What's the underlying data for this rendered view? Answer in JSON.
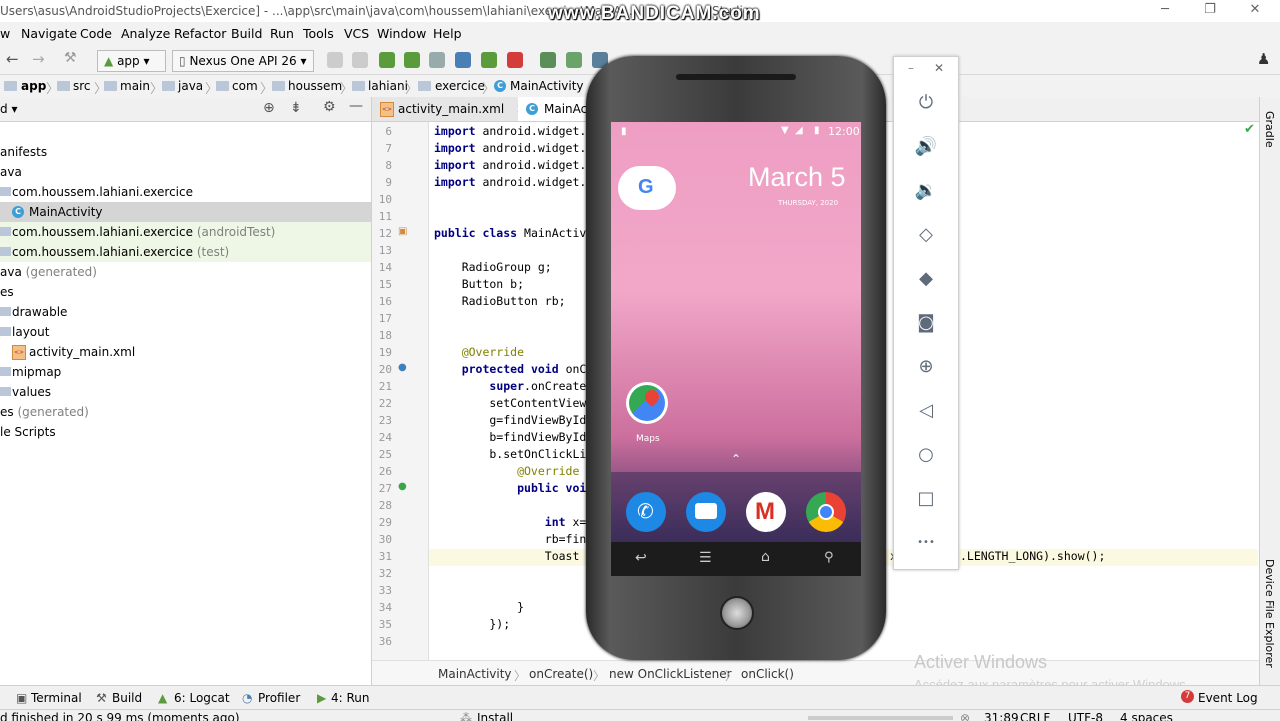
{
  "window": {
    "title": "Users\\asus\\AndroidStudioProjects\\Exercice] - ...\\app\\src\\main\\java\\com\\houssem\\lahiani\\exercice\\MainA...",
    "title_tail": "Studio",
    "watermark": "www.BANDICAM.com",
    "min": "─",
    "max": "❐",
    "close": "✕"
  },
  "menu": [
    "w",
    "Navigate",
    "Code",
    "Analyze",
    "Refactor",
    "Build",
    "Run",
    "Tools",
    "VCS",
    "Window",
    "Help"
  ],
  "toolbar": {
    "module": "app",
    "device": "Nexus One API 26"
  },
  "breadcrumbs": [
    "app",
    "src",
    "main",
    "java",
    "com",
    "houssem",
    "lahiani",
    "exercice",
    "MainActivity"
  ],
  "project": {
    "view": "d",
    "tree": [
      {
        "label": "anifests",
        "muted": ""
      },
      {
        "label": "ava",
        "muted": ""
      },
      {
        "label": "com.houssem.lahiani.exercice",
        "muted": ""
      },
      {
        "label": "MainActivity",
        "muted": ""
      },
      {
        "label": "com.houssem.lahiani.exercice",
        "muted": "(androidTest)"
      },
      {
        "label": "com.houssem.lahiani.exercice",
        "muted": "(test)"
      },
      {
        "label": "ava",
        "muted": "(generated)"
      },
      {
        "label": "es",
        "muted": ""
      },
      {
        "label": "drawable",
        "muted": ""
      },
      {
        "label": "layout",
        "muted": ""
      },
      {
        "label": "activity_main.xml",
        "muted": ""
      },
      {
        "label": "mipmap",
        "muted": ""
      },
      {
        "label": "values",
        "muted": ""
      },
      {
        "label": "es",
        "muted": "(generated)"
      },
      {
        "label": "le Scripts",
        "muted": ""
      }
    ]
  },
  "editor": {
    "tabs": [
      "activity_main.xml",
      "MainAct"
    ],
    "lines": [
      {
        "n": "6",
        "t": "import android.widget."
      },
      {
        "n": "7",
        "t": "import android.widget."
      },
      {
        "n": "8",
        "t": "import android.widget."
      },
      {
        "n": "9",
        "t": "import android.widget."
      },
      {
        "n": "10",
        "t": ""
      },
      {
        "n": "11",
        "t": ""
      },
      {
        "n": "12",
        "t": "public class MainActiv"
      },
      {
        "n": "13",
        "t": ""
      },
      {
        "n": "14",
        "t": "    RadioGroup g;"
      },
      {
        "n": "15",
        "t": "    Button b;"
      },
      {
        "n": "16",
        "t": "    RadioButton rb;"
      },
      {
        "n": "17",
        "t": ""
      },
      {
        "n": "18",
        "t": ""
      },
      {
        "n": "19",
        "t": "    @Override"
      },
      {
        "n": "20",
        "t": "    protected void onC"
      },
      {
        "n": "21",
        "t": "        super.onCreate"
      },
      {
        "n": "22",
        "t": "        setContentView"
      },
      {
        "n": "23",
        "t": "        g=findViewById"
      },
      {
        "n": "24",
        "t": "        b=findViewById"
      },
      {
        "n": "25",
        "t": "        b.setOnClickLi"
      },
      {
        "n": "26",
        "t": "            @Override"
      },
      {
        "n": "27",
        "t": "            public voi"
      },
      {
        "n": "28",
        "t": ""
      },
      {
        "n": "29",
        "t": "                int x="
      },
      {
        "n": "30",
        "t": "                rb=fin"
      },
      {
        "n": "31",
        "t": "                Toast"
      },
      {
        "n": "32",
        "t": ""
      },
      {
        "n": "33",
        "t": ""
      },
      {
        "n": "34",
        "t": "            }"
      },
      {
        "n": "35",
        "t": "        });"
      },
      {
        "n": "36",
        "t": ""
      }
    ],
    "line31_tail": "x",
    "line31_end": ".LENGTH_LONG).show();",
    "crumbs": [
      "MainActivity",
      "onCreate()",
      "new OnClickListener",
      "onClick()"
    ]
  },
  "right_strip": {
    "gradle": "Gradle",
    "device_explorer": "Device File Explorer"
  },
  "activate": {
    "line1": "Activer Windows",
    "line2": "Accédez aux paramètres pour activer Windows"
  },
  "bottom_tools": [
    "Terminal",
    "Build",
    "6: Logcat",
    "Profiler",
    "4: Run"
  ],
  "event_log": {
    "count": "7",
    "label": "Event Log"
  },
  "status": {
    "message": "d finished in 20 s 99 ms (moments ago)",
    "install": "Install",
    "position": "31:89",
    "line_sep": "CRLF",
    "encoding": "UTF-8",
    "indent": "4 spaces"
  },
  "phone": {
    "time": "12:00",
    "date": "March 5",
    "weekday": "THURSDAY, 2020",
    "maps_label": "Maps"
  },
  "emulator_controls": [
    "power-icon",
    "volume-up-icon",
    "volume-down-icon",
    "rotate-left-icon",
    "rotate-right-icon",
    "camera-icon",
    "zoom-icon",
    "back-icon",
    "home-icon",
    "overview-icon",
    "more-icon"
  ]
}
